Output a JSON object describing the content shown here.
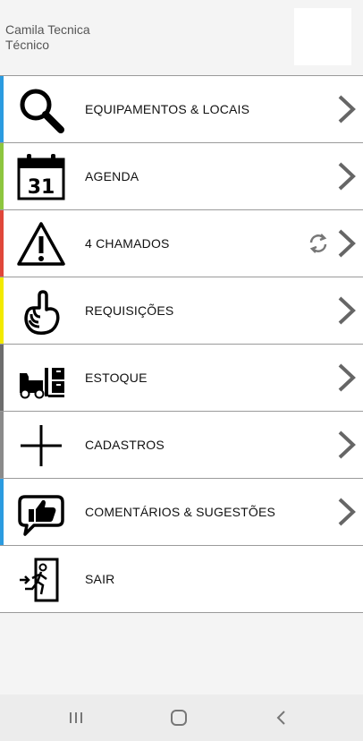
{
  "header": {
    "user_name": "Camila Tecnica",
    "user_role": "Técnico"
  },
  "menu": {
    "items": [
      {
        "label": "EQUIPAMENTOS & LOCAIS",
        "icon": "search-icon",
        "color": "#2b9be0",
        "has_arrow": true
      },
      {
        "label": "AGENDA",
        "icon": "calendar-icon",
        "color": "#8dc63f",
        "has_arrow": true,
        "calendar_day": "31"
      },
      {
        "label": "4 CHAMADOS",
        "icon": "warning-icon",
        "color": "#e0473a",
        "has_arrow": true,
        "has_refresh": true
      },
      {
        "label": "REQUISIÇÕES",
        "icon": "raised-hand-icon",
        "color": "#f2ea00",
        "has_arrow": true
      },
      {
        "label": "ESTOQUE",
        "icon": "forklift-icon",
        "color": "#6d6d6d",
        "has_arrow": true
      },
      {
        "label": "CADASTROS",
        "icon": "plus-icon",
        "color": "#8a8a8a",
        "has_arrow": true
      },
      {
        "label": "COMENTÁRIOS & SUGESTÕES",
        "icon": "thumbs-up-chat-icon",
        "color": "#2b9be0",
        "has_arrow": true
      },
      {
        "label": "SAIR",
        "icon": "exit-icon",
        "color": "#ffffff",
        "has_arrow": false
      }
    ]
  },
  "system_nav": {
    "recents": "recents-icon",
    "home": "home-icon",
    "back": "back-icon"
  }
}
